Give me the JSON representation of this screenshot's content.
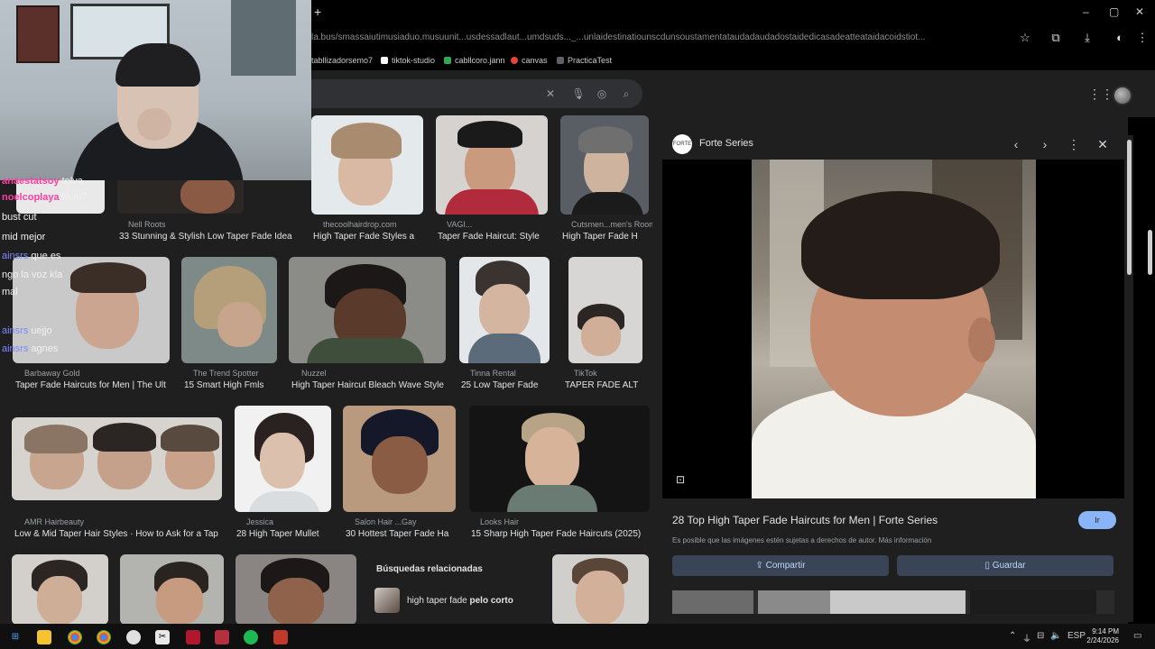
{
  "browser": {
    "new_tab": "+",
    "window_controls": [
      "–",
      "▢",
      "✕"
    ],
    "url": "la.bus/smassaiutimusiaduo.musuunit...usdessadlaut...umdsuds..._...unlaidestinatiounscdunsoustamentataudadaudadostaidedicasadeatteataidacoidstiot...",
    "bookmarks": [
      {
        "label": "tabllizadorsemo7",
        "color": "#4a4a4a"
      },
      {
        "label": "tiktok-studio",
        "color": "#ffffff"
      },
      {
        "label": "cabllcoro.jann",
        "color": "#34a853"
      },
      {
        "label": "canvas",
        "color": "#ea4335"
      },
      {
        "label": "PracticaTest",
        "color": "#5f6368"
      }
    ]
  },
  "chat": [
    {
      "user": "anaestatsoy",
      "text": "tolva"
    },
    {
      "user": "noelcoplaya",
      "text": "fo.m?"
    },
    {
      "user": "",
      "text": "bust cut"
    },
    {
      "user": "",
      "text": "mid mejor"
    },
    {
      "user": "ainsrs",
      "text": "que es"
    },
    {
      "user": "",
      "text": "ngo la voz kla"
    },
    {
      "user": "",
      "text": "mal"
    },
    {
      "user": "",
      "text": ""
    },
    {
      "user": "ainsrs",
      "text": "uejjo"
    },
    {
      "user": "ainsrs",
      "text": "agnes"
    }
  ],
  "results": {
    "row1": [
      {
        "source": "",
        "caption": ""
      },
      {
        "source": "Nell Roots",
        "caption": "33 Stunning & Stylish Low Taper Fade Idea"
      },
      {
        "source": "thecoolhairdrop.com",
        "caption": "High Taper Fade Styles a"
      },
      {
        "source": "VAGI...",
        "caption": "Taper Fade Haircut: Style"
      },
      {
        "source": "Cutsmen...men's Room",
        "caption": "High Taper Fade H"
      }
    ],
    "row2": [
      {
        "source": "Barbaway Gold",
        "caption": "Taper Fade Haircuts for Men | The Ult"
      },
      {
        "source": "The Trend Spotter",
        "caption": "15 Smart High Fmls"
      },
      {
        "source": "Nuzzel",
        "caption": "High Taper Haircut Bleach Wave Style"
      },
      {
        "source": "Tinna Rental",
        "caption": "25 Low Taper Fade"
      },
      {
        "source": "TikTok",
        "caption": "TAPER FADE ALT"
      }
    ],
    "row3": [
      {
        "source": "AMR Hairbeauty",
        "caption": "Low & Mid Taper Hair Styles · How to Ask for a Tap"
      },
      {
        "source": "Jessica",
        "caption": "28 High Taper Mullet"
      },
      {
        "source": "Salon Hair ...Gay",
        "caption": "30 Hottest Taper Fade Ha"
      },
      {
        "source": "Looks Hair",
        "caption": "15 Sharp High Taper Fade Haircuts (2025)"
      }
    ],
    "related": {
      "title": "Búsquedas relacionadas",
      "item_prefix": "high taper fade",
      "item_bold": "pelo corto"
    }
  },
  "panel": {
    "site": "Forte Series",
    "logo_text": "FORTE",
    "title": "28 Top High Taper Fade Haircuts for Men | Forte Series",
    "visit": "Ir",
    "note": "Es posible que las imágenes estén sujetas a derechos de autor. Más información",
    "share": "Compartir",
    "save": "Guardar"
  },
  "taskbar": {
    "time": "9:14 PM",
    "date": "2/24/2026",
    "lang": "ESP"
  }
}
